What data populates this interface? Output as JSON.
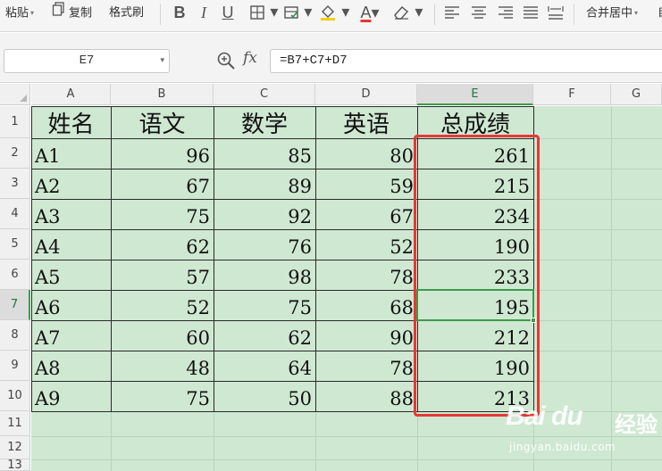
{
  "toolbar": {
    "paste_label": "粘贴",
    "copy_label": "复制",
    "format_painter_label": "格式刷",
    "bold_glyph": "B",
    "italic_glyph": "I",
    "underline_glyph": "U",
    "font_color_glyph": "A",
    "merge_center_label": "合并居中",
    "truncated_label": "自"
  },
  "formula_bar": {
    "name_box": "E7",
    "fx_label": "fx",
    "formula": "=B7+C7+D7"
  },
  "columns": [
    "A",
    "B",
    "C",
    "D",
    "E",
    "F",
    "G"
  ],
  "rows": [
    "1",
    "2",
    "3",
    "4",
    "5",
    "6",
    "7",
    "8",
    "9",
    "10",
    "11",
    "12",
    "13"
  ],
  "selected_cell": "E7",
  "table": {
    "headers": [
      "姓名",
      "语文",
      "数学",
      "英语",
      "总成绩"
    ],
    "data": [
      [
        "A1",
        "96",
        "85",
        "80",
        "261"
      ],
      [
        "A2",
        "67",
        "89",
        "59",
        "215"
      ],
      [
        "A3",
        "75",
        "92",
        "67",
        "234"
      ],
      [
        "A4",
        "62",
        "76",
        "52",
        "190"
      ],
      [
        "A5",
        "57",
        "98",
        "78",
        "233"
      ],
      [
        "A6",
        "52",
        "75",
        "68",
        "195"
      ],
      [
        "A7",
        "60",
        "62",
        "90",
        "212"
      ],
      [
        "A8",
        "48",
        "64",
        "78",
        "190"
      ],
      [
        "A9",
        "75",
        "50",
        "88",
        "213"
      ]
    ]
  },
  "colors": {
    "cell_fill": "#cfe8d2",
    "selection": "#3c9b4d",
    "highlight_box": "#e53935"
  },
  "watermark": {
    "logo": "Bai du",
    "chinese": "经验",
    "url": "jingyan.baidu.com"
  }
}
